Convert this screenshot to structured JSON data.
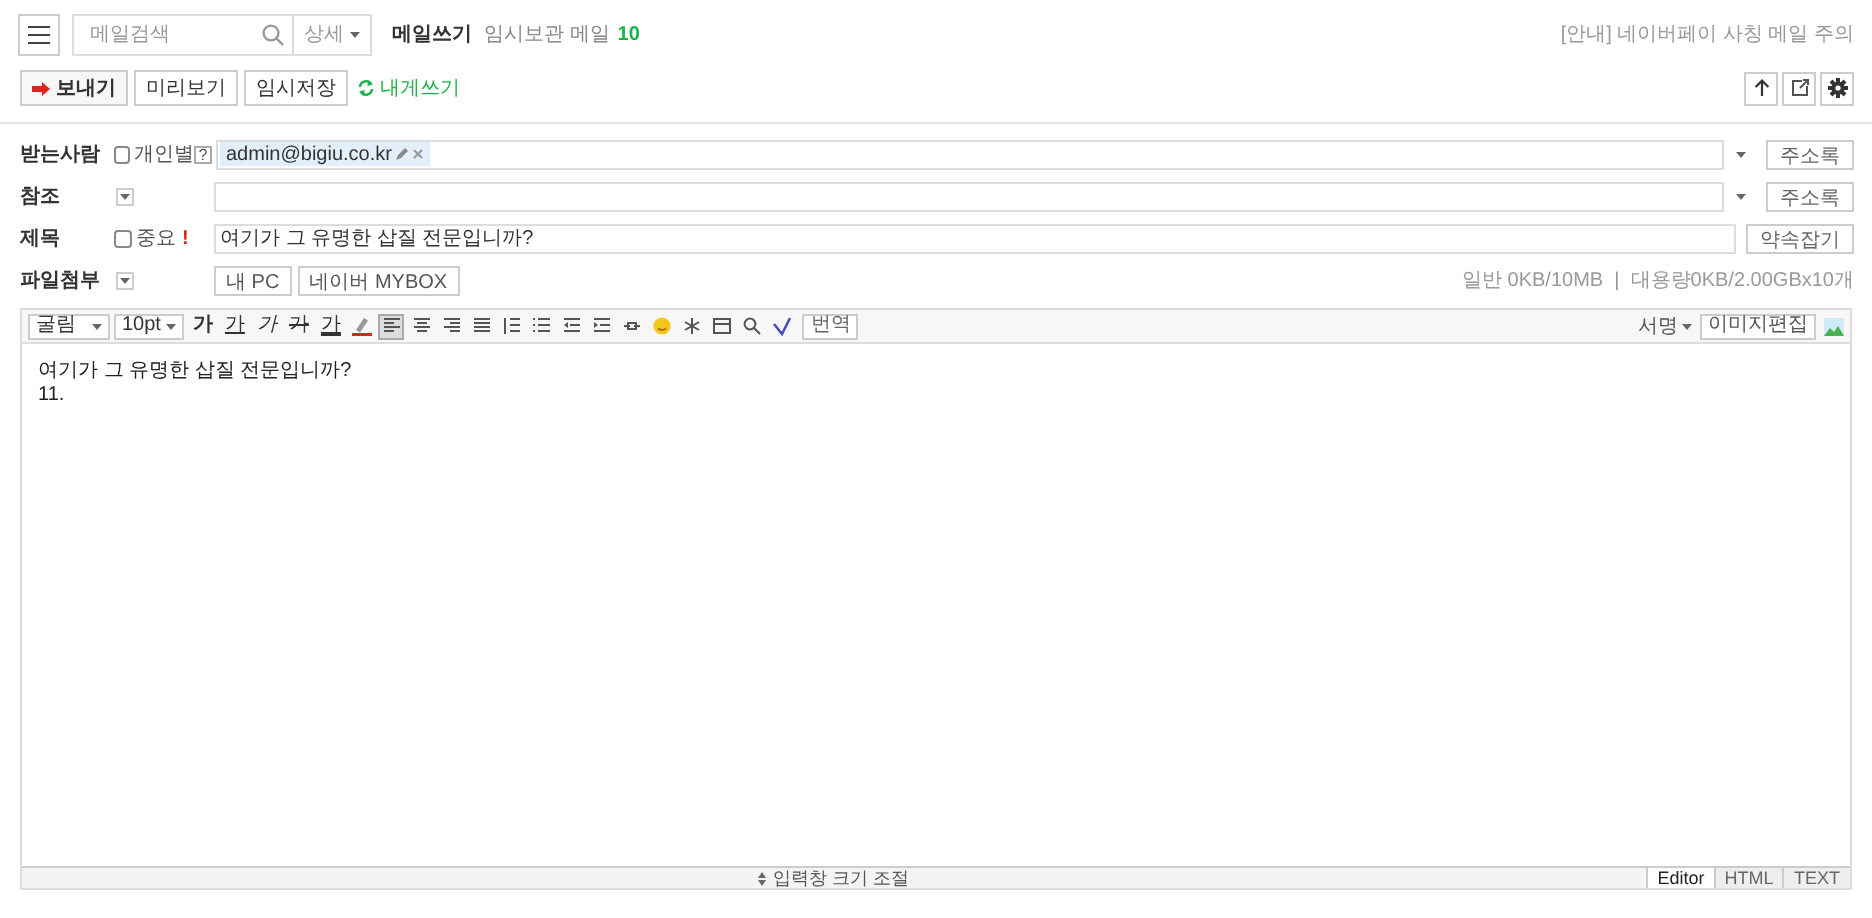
{
  "search": {
    "placeholder": "메일검색",
    "detail": "상세"
  },
  "page_title": "메일쓰기",
  "drafts_label": "임시보관 메일",
  "drafts_count": "10",
  "notice": "[안내] 네이버페이 사칭 메일 주의",
  "actions": [
    {
      "label": "보내기",
      "kind": "send"
    },
    {
      "label": "미리보기",
      "kind": "plain"
    },
    {
      "label": "임시저장",
      "kind": "plain"
    },
    {
      "label": "내게쓰기",
      "kind": "link"
    }
  ],
  "tools": [
    {
      "kind": "up"
    },
    {
      "kind": "popout"
    },
    {
      "kind": "settings"
    }
  ],
  "to": {
    "label": "받는사람",
    "option": "개인별",
    "option_checked": false,
    "help": "?",
    "chip": "admin@bigiu.co.kr",
    "button": "주소록"
  },
  "cc": {
    "label": "참조",
    "button": "주소록"
  },
  "subject": {
    "label": "제목",
    "option": "중요",
    "option_checked": false,
    "mark": "!",
    "value": "여기가 그 유명한 삽질 전문입니까?",
    "button": "약속잡기"
  },
  "attach": {
    "label": "파일첨부",
    "buttons": [
      "내 PC",
      "네이버 MYBOX"
    ],
    "info": "일반 0KB/10MB  |  대용량0KB/2.00GBx10개"
  },
  "toolbar": [
    {
      "kind": "select",
      "label": "굴림"
    },
    {
      "kind": "select",
      "label": "10pt"
    },
    {
      "kind": "bold",
      "label": "가"
    },
    {
      "kind": "underline",
      "label": "가"
    },
    {
      "kind": "italic",
      "label": "가"
    },
    {
      "kind": "strike",
      "label": "가"
    },
    {
      "kind": "font-color",
      "label": "가"
    },
    {
      "kind": "highlight"
    },
    {
      "kind": "align-left",
      "selected": true
    },
    {
      "kind": "align-center",
      "selected": false
    },
    {
      "kind": "align-right",
      "selected": false
    },
    {
      "kind": "justify",
      "selected": false
    },
    {
      "kind": "line-height"
    },
    {
      "kind": "list"
    },
    {
      "kind": "outdent"
    },
    {
      "kind": "indent"
    },
    {
      "kind": "url"
    },
    {
      "kind": "emoji"
    },
    {
      "kind": "special"
    },
    {
      "kind": "table"
    },
    {
      "kind": "find"
    },
    {
      "kind": "spell"
    },
    {
      "kind": "text-button",
      "label": "번역"
    }
  ],
  "toolbar_right": {
    "signature": "서명",
    "image_edit": "이미지편집"
  },
  "body": [
    "여기가 그 유명한 삽질 전문입니까?",
    "11."
  ],
  "resize": "입력창 크기 조절",
  "modes": [
    {
      "label": "Editor",
      "selected": true
    },
    {
      "label": "HTML",
      "selected": false
    },
    {
      "label": "TEXT",
      "selected": false
    }
  ]
}
